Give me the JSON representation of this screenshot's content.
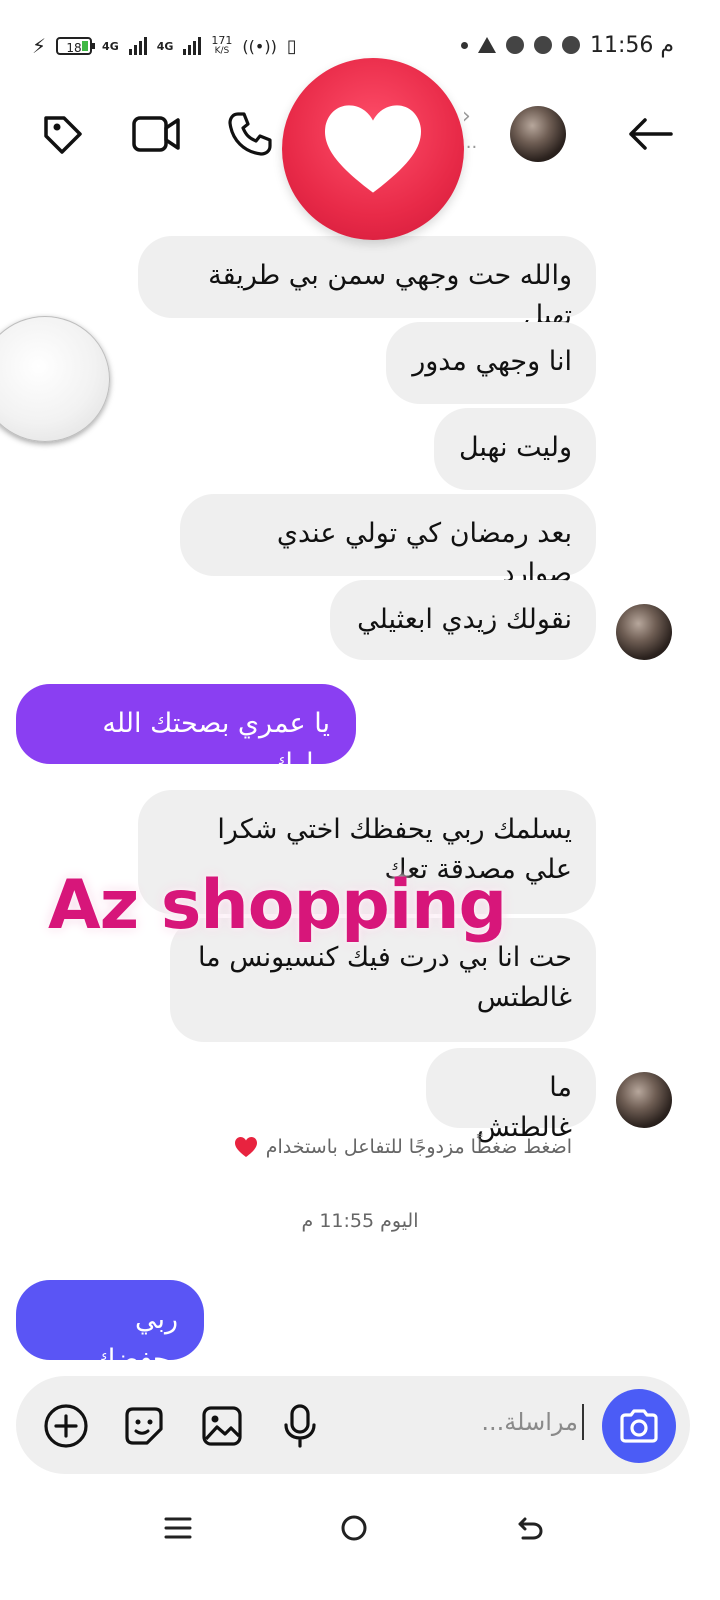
{
  "status_bar": {
    "battery": "18",
    "network_1": "4G",
    "network_2": "4G",
    "speed_value": "171",
    "speed_unit": "K/S",
    "time": "11:56 م"
  },
  "header": {
    "back": "back-arrow-icon",
    "chevron": "›",
    "dots": "..."
  },
  "messages": [
    {
      "text": "والله حت وجهي سمن بي طريقة تهبل"
    },
    {
      "text": "انا وجهي مدور"
    },
    {
      "text": "وليت نهبل"
    },
    {
      "text": "بعد رمضان كي تولي عندي صوارد"
    },
    {
      "text": "نقولك زيدي ابعثيلي"
    },
    {
      "text": "يا عمري بصحتك الله يبارك"
    },
    {
      "text": "يسلمك ربي يحفظك اختي شكرا علي مصدقة تعك"
    },
    {
      "text": "حت انا بي درت فيك كنسيونس ما غالطتس"
    },
    {
      "text": "ما غالطتش"
    },
    {
      "text": "ربي يحفضك"
    }
  ],
  "watermark": "Az shopping",
  "hint": "اضغط ضغطًا مزدوجًا للتفاعل باستخدام",
  "timestamp": "اليوم 11:55 م",
  "composer": {
    "placeholder": "مراسلة..."
  },
  "colors": {
    "outgoing_purple": "#8a3ff2",
    "outgoing_blue": "#5a55f5",
    "incoming": "#efefef",
    "heart": "#e82a48",
    "watermark": "#d7167a",
    "camera": "#4b5cf6"
  }
}
